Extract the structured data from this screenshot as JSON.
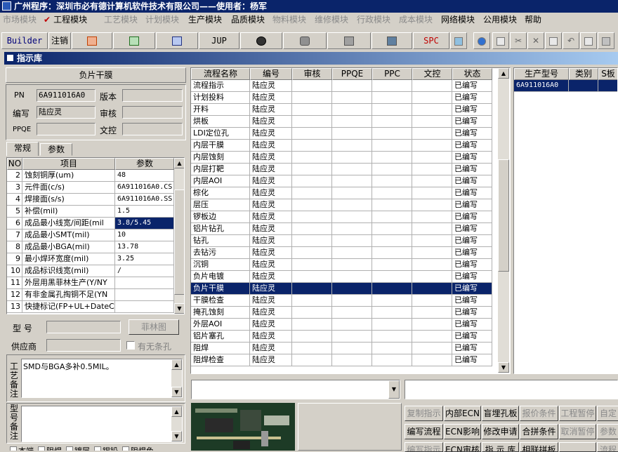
{
  "window": {
    "title": "广州程序：深圳市必有德计算机软件技术有限公司——使用者：杨军"
  },
  "menu": [
    {
      "label": "市场模块",
      "enabled": false
    },
    {
      "label": "工程模块",
      "enabled": true,
      "checked": true
    },
    {
      "label": "工艺模块",
      "enabled": false
    },
    {
      "label": "计划模块",
      "enabled": false
    },
    {
      "label": "生产模块",
      "enabled": true
    },
    {
      "label": "品质模块",
      "enabled": true
    },
    {
      "label": "物料模块",
      "enabled": false
    },
    {
      "label": "维修模块",
      "enabled": false
    },
    {
      "label": "行政模块",
      "enabled": false
    },
    {
      "label": "成本模块",
      "enabled": false
    },
    {
      "label": "网络模块",
      "enabled": true
    },
    {
      "label": "公用模块",
      "enabled": true
    },
    {
      "label": "帮助",
      "enabled": true
    }
  ],
  "toolbar": {
    "builder": "Builder",
    "logout": "注销",
    "jup": "JUP",
    "spc": "SPC"
  },
  "subwindow": {
    "title": "指示库"
  },
  "left": {
    "header": "负片干膜",
    "pn_label": "PN",
    "pn_value": "6A911016A0",
    "version_label": "版本",
    "version_value": "",
    "author_label": "编写",
    "author_value": "陆应灵",
    "review_label": "审核",
    "review_value": "",
    "ppqe_label": "PPQE",
    "ppqe_value": "",
    "doc_label": "文控",
    "doc_value": "",
    "tab_general": "常规",
    "tab_params": "参数",
    "param_headers": [
      "NO",
      "项目",
      "参数"
    ],
    "params": [
      {
        "no": "2",
        "item": "蚀刻铜厚(um)",
        "value": "48"
      },
      {
        "no": "3",
        "item": "元件面(c/s)",
        "value": "6A911016A0.CS"
      },
      {
        "no": "4",
        "item": "焊接面(s/s)",
        "value": "6A911016A0.SS"
      },
      {
        "no": "5",
        "item": "补偿(mil)",
        "value": "1.5"
      },
      {
        "no": "6",
        "item": "成品最小线宽/间距(mil",
        "value": "3.8/5.45"
      },
      {
        "no": "7",
        "item": "成品最小SMT(mil)",
        "value": "10"
      },
      {
        "no": "8",
        "item": "成品最小BGA(mil)",
        "value": "13.78"
      },
      {
        "no": "9",
        "item": "最小焊环宽度(mil)",
        "value": "3.25"
      },
      {
        "no": "10",
        "item": "成品标识线宽(mil)",
        "value": "/"
      },
      {
        "no": "11",
        "item": "外层用黑菲林生产(Y/NY",
        "value": ""
      },
      {
        "no": "12",
        "item": "有非金属孔掏铜不足(YN",
        "value": ""
      },
      {
        "no": "13",
        "item": "快捷标记(FP+UL+DateC/",
        "value": ""
      }
    ],
    "model_label": "型  号",
    "model_value": "",
    "film_button": "菲林图",
    "supplier_label": "供应商",
    "supplier_value": "",
    "slot_label": "有无条孔",
    "process_note_label": "工艺备注",
    "process_note": "SMD与BGA多补0.5MIL。",
    "model_note_label": "型号备注",
    "model_note": "",
    "bottom_checks": [
      "本端",
      "阻焊",
      "镀层",
      "锡铅",
      "阻焊色"
    ]
  },
  "process_table": {
    "headers": [
      "流程名称",
      "编号",
      "审核",
      "PPQE",
      "PPC",
      "文控",
      "状态"
    ],
    "rows": [
      {
        "name": "流程指示",
        "author": "陆应灵",
        "status": "已编写"
      },
      {
        "name": "计划投料",
        "author": "陆应灵",
        "status": "已编写"
      },
      {
        "name": "开料",
        "author": "陆应灵",
        "status": "已编写"
      },
      {
        "name": "烘板",
        "author": "陆应灵",
        "status": "已编写"
      },
      {
        "name": "LDI定位孔",
        "author": "陆应灵",
        "status": "已编写"
      },
      {
        "name": "内层干膜",
        "author": "陆应灵",
        "status": "已编写"
      },
      {
        "name": "内层蚀刻",
        "author": "陆应灵",
        "status": "已编写"
      },
      {
        "name": "内层打靶",
        "author": "陆应灵",
        "status": "已编写"
      },
      {
        "name": "内层AOI",
        "author": "陆应灵",
        "status": "已编写"
      },
      {
        "name": "棕化",
        "author": "陆应灵",
        "status": "已编写"
      },
      {
        "name": "层压",
        "author": "陆应灵",
        "status": "已编写"
      },
      {
        "name": "锣板边",
        "author": "陆应灵",
        "status": "已编写"
      },
      {
        "name": "铝片钻孔",
        "author": "陆应灵",
        "status": "已编写"
      },
      {
        "name": "钻孔",
        "author": "陆应灵",
        "status": "已编写"
      },
      {
        "name": "去钻污",
        "author": "陆应灵",
        "status": "已编写"
      },
      {
        "name": "沉铜",
        "author": "陆应灵",
        "status": "已编写"
      },
      {
        "name": "负片电镀",
        "author": "陆应灵",
        "status": "已编写"
      },
      {
        "name": "负片干膜",
        "author": "陆应灵",
        "status": "已编写",
        "selected": true
      },
      {
        "name": "干膜检查",
        "author": "陆应灵",
        "status": "已编写"
      },
      {
        "name": "掩孔蚀刻",
        "author": "陆应灵",
        "status": "已编写"
      },
      {
        "name": "外层AOI",
        "author": "陆应灵",
        "status": "已编写"
      },
      {
        "name": "铝片塞孔",
        "author": "陆应灵",
        "status": "已编写"
      },
      {
        "name": "阻焊",
        "author": "陆应灵",
        "status": "已编写"
      },
      {
        "name": "阻焊检查",
        "author": "陆应灵",
        "status": "已编写"
      }
    ]
  },
  "product_table": {
    "headers": [
      "生产型号",
      "类别",
      "S板"
    ],
    "rows": [
      {
        "model": "6A911016A0",
        "category": "",
        "s": ""
      }
    ]
  },
  "action_buttons": {
    "row1": [
      {
        "label": "复制指示",
        "enabled": false
      },
      {
        "label": "内部ECN",
        "enabled": true
      },
      {
        "label": "盲埋孔板",
        "enabled": true
      },
      {
        "label": "报价条件",
        "enabled": false
      },
      {
        "label": "工程暂停",
        "enabled": false
      },
      {
        "label": "自定",
        "enabled": false
      }
    ],
    "row2": [
      {
        "label": "编写流程",
        "enabled": true
      },
      {
        "label": "ECN影响",
        "enabled": true
      },
      {
        "label": "修改申请",
        "enabled": true
      },
      {
        "label": "合拼条件",
        "enabled": true
      },
      {
        "label": "取消暂停",
        "enabled": false
      },
      {
        "label": "参数",
        "enabled": false
      }
    ],
    "row3": [
      {
        "label": "编写指示",
        "enabled": false
      },
      {
        "label": "ECN审核",
        "enabled": true
      },
      {
        "label": "指 示 库",
        "enabled": true
      },
      {
        "label": "相联拼板",
        "enabled": true
      },
      {
        "label": "",
        "enabled": false
      },
      {
        "label": "流程",
        "enabled": false
      }
    ]
  }
}
